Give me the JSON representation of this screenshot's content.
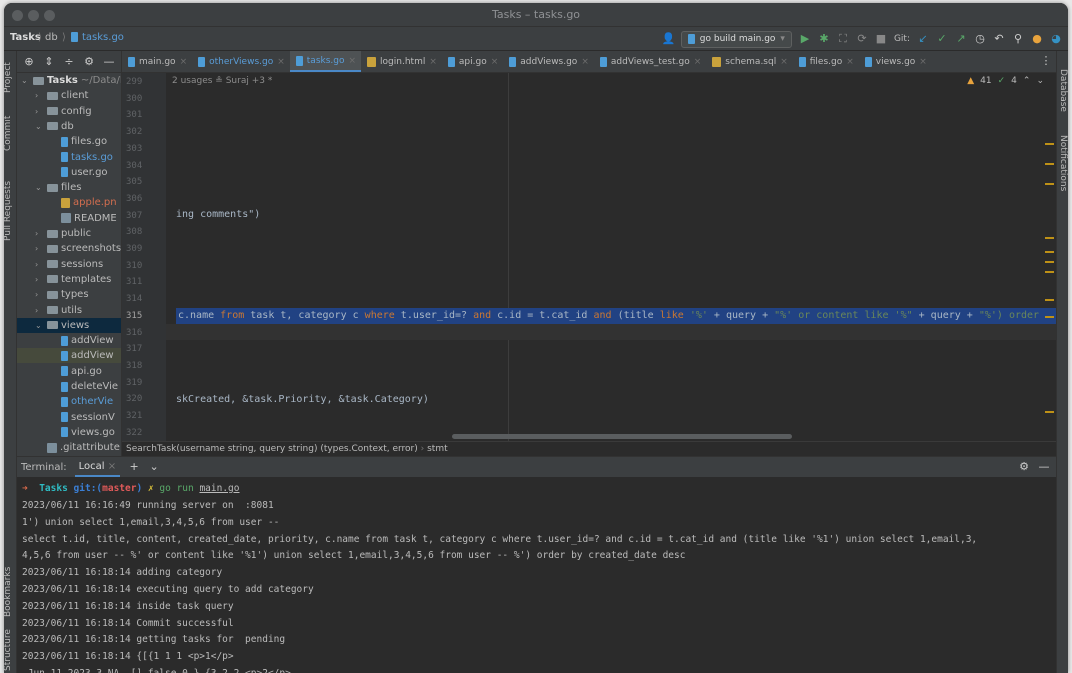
{
  "window": {
    "title": "Tasks – tasks.go"
  },
  "navbar": {
    "project": "Tasks",
    "folder": "db",
    "file": "tasks.go",
    "run_config": "go build main.go",
    "git_label": "Git:"
  },
  "left_strip": {
    "project": "Project",
    "commit": "Commit",
    "pull_requests": "Pull Requests",
    "bookmarks": "Bookmarks",
    "structure": "Structure"
  },
  "right_strip": {
    "database": "Database",
    "notifications": "Notifications"
  },
  "project_tree": [
    {
      "label": "Tasks",
      "suffix": "~/Data/L",
      "kind": "folder",
      "indent": 0,
      "expanded": true,
      "bold": true
    },
    {
      "label": "client",
      "kind": "folder",
      "indent": 1,
      "expanded": false
    },
    {
      "label": "config",
      "kind": "folder",
      "indent": 1,
      "expanded": false
    },
    {
      "label": "db",
      "kind": "folder",
      "indent": 1,
      "expanded": true
    },
    {
      "label": "files.go",
      "kind": "go",
      "indent": 2
    },
    {
      "label": "tasks.go",
      "kind": "go",
      "indent": 2,
      "color": "#5a9dd8"
    },
    {
      "label": "user.go",
      "kind": "go",
      "indent": 2
    },
    {
      "label": "files",
      "kind": "folder",
      "indent": 1,
      "expanded": true
    },
    {
      "label": "apple.pn",
      "kind": "img",
      "indent": 2,
      "color": "#d36e4f"
    },
    {
      "label": "README",
      "kind": "md",
      "indent": 2
    },
    {
      "label": "public",
      "kind": "folder",
      "indent": 1,
      "expanded": false
    },
    {
      "label": "screenshots",
      "kind": "folder",
      "indent": 1,
      "expanded": false
    },
    {
      "label": "sessions",
      "kind": "folder",
      "indent": 1,
      "expanded": false
    },
    {
      "label": "templates",
      "kind": "folder",
      "indent": 1,
      "expanded": false
    },
    {
      "label": "types",
      "kind": "folder",
      "indent": 1,
      "expanded": false
    },
    {
      "label": "utils",
      "kind": "folder",
      "indent": 1,
      "expanded": false
    },
    {
      "label": "views",
      "kind": "folder",
      "indent": 1,
      "expanded": true,
      "selected": true
    },
    {
      "label": "addView",
      "kind": "go",
      "indent": 2
    },
    {
      "label": "addView",
      "kind": "go",
      "indent": 2,
      "highlight": true
    },
    {
      "label": "api.go",
      "kind": "go",
      "indent": 2
    },
    {
      "label": "deleteVie",
      "kind": "go",
      "indent": 2
    },
    {
      "label": "otherVie",
      "kind": "go",
      "indent": 2,
      "color": "#5a9dd8"
    },
    {
      "label": "sessionV",
      "kind": "go",
      "indent": 2
    },
    {
      "label": "views.go",
      "kind": "go",
      "indent": 2
    },
    {
      "label": ".gitattribute",
      "kind": "md",
      "indent": 1
    }
  ],
  "tabs": [
    {
      "label": "main.go",
      "kind": "go"
    },
    {
      "label": "otherViews.go",
      "kind": "go",
      "color": "#5a9dd8"
    },
    {
      "label": "tasks.go",
      "kind": "go",
      "active": true,
      "color": "#5a9dd8"
    },
    {
      "label": "login.html",
      "kind": "html"
    },
    {
      "label": "api.go",
      "kind": "go"
    },
    {
      "label": "addViews.go",
      "kind": "go"
    },
    {
      "label": "addViews_test.go",
      "kind": "go"
    },
    {
      "label": "schema.sql",
      "kind": "sql"
    },
    {
      "label": "files.go",
      "kind": "go"
    },
    {
      "label": "views.go",
      "kind": "go"
    }
  ],
  "editor": {
    "usages": "2 usages   ≗ Suraj +3 *",
    "warnings": "41",
    "checks": "4",
    "line_numbers": [
      "299",
      "300",
      "301",
      "302",
      "303",
      "304",
      "305",
      "306",
      "307",
      "308",
      "309",
      "310",
      "311",
      "314",
      "315",
      "316",
      "317",
      "318",
      "319",
      "320",
      "321",
      "322"
    ],
    "current_line": "315",
    "line_307": "ing comments\")",
    "line_315": {
      "a": "c.name ",
      "from": "from",
      "b": " task t, category c ",
      "where": "where",
      "c": " t.user_id=? ",
      "and1": "and",
      "d": " c.id = t.cat_id ",
      "and2": "and",
      "e": " (title ",
      "like1": "like",
      "s1": " '%'",
      "f": " + query + ",
      "s2": "\"%' or content like '%\"",
      "g": " + query + ",
      "s3": "\"%') order"
    },
    "line_320": "skCreated, &task.Priority, &task.Category)"
  },
  "breadcrumb": {
    "func": "SearchTask(username string, query string) (types.Context, error)",
    "stmt": "stmt"
  },
  "terminal": {
    "title": "Terminal:",
    "tab": "Local",
    "prompt": {
      "arrow": "➜",
      "dir": "Tasks",
      "git": "git:(",
      "branch": "master",
      "git_close": ")",
      "x": "✗",
      "cmd": "go run ",
      "file": "main.go"
    },
    "lines": [
      "2023/06/11 16:16:49 running server on  :8081",
      "1') union select 1,email,3,4,5,6 from user --",
      "select t.id, title, content, created_date, priority, c.name from task t, category c where t.user_id=? and c.id = t.cat_id and (title like '%1') union select 1,email,3,",
      "4,5,6 from user -- %' or content like '%1') union select 1,email,3,4,5,6 from user -- %') order by created_date desc",
      "2023/06/11 16:18:14 adding category",
      "2023/06/11 16:18:14 executing query to add category",
      "2023/06/11 16:18:14 inside task query",
      "2023/06/11 16:18:14 Commit successful",
      "2023/06/11 16:18:14 getting tasks for  pending",
      "2023/06/11 16:18:14 {[{1 1 1 <p>1</p>",
      " Jun 11 2023 3 NA  [] false 0 } {3 2 2 <p>2</p>"
    ]
  }
}
